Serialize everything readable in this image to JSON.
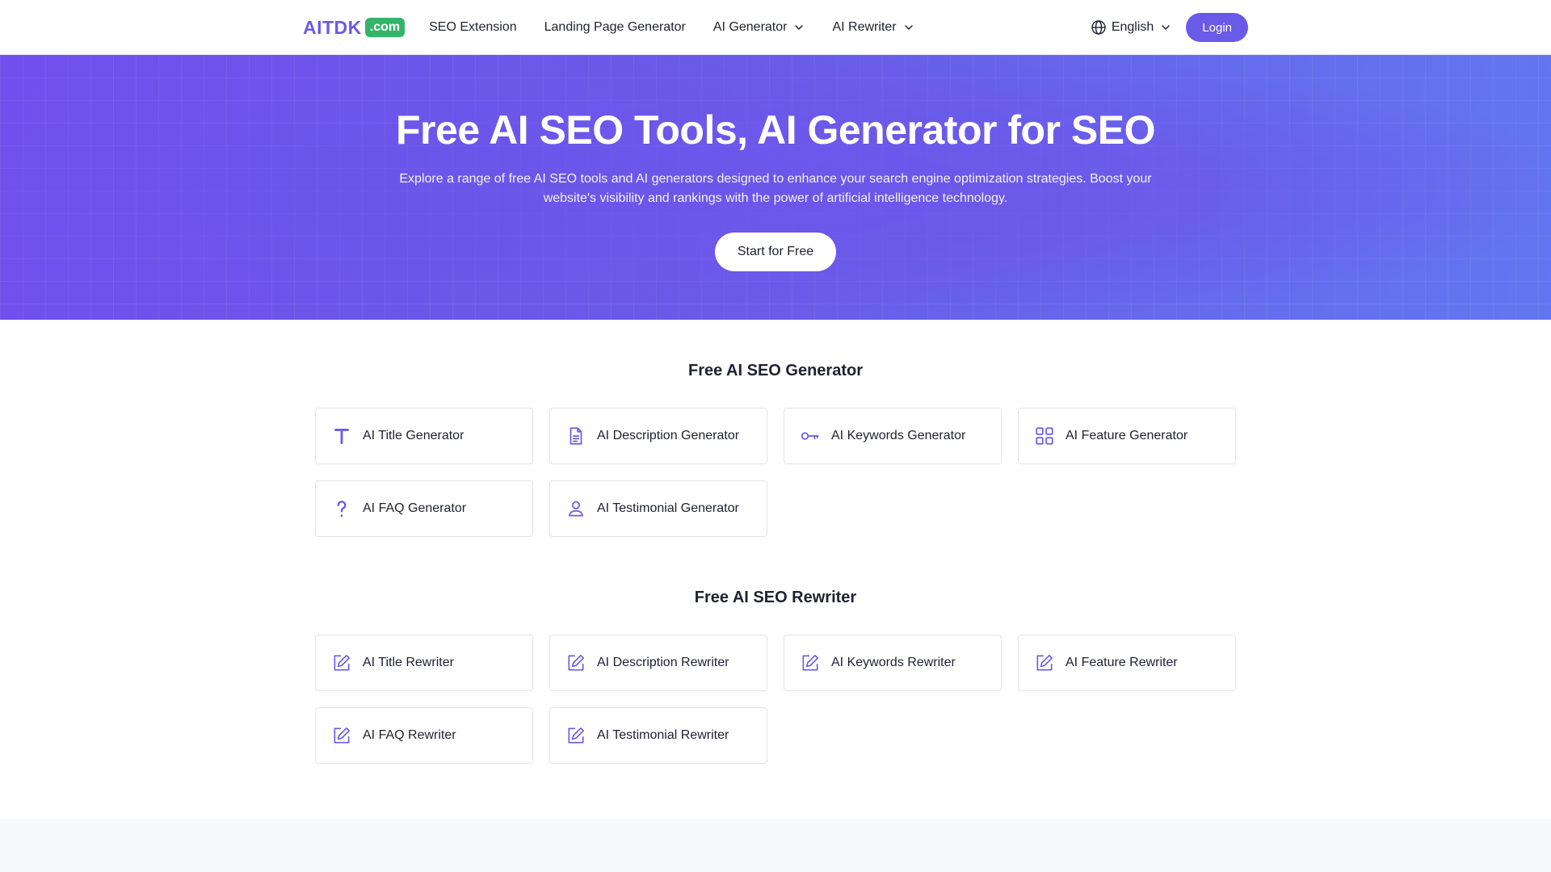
{
  "header": {
    "logo_text": "AITDK",
    "logo_badge": ".com",
    "nav": [
      {
        "label": "SEO Extension"
      },
      {
        "label": "Landing Page Generator"
      },
      {
        "label": "AI Generator"
      },
      {
        "label": "AI Rewriter"
      }
    ],
    "language": "English",
    "login_label": "Login"
  },
  "hero": {
    "title": "Free AI SEO Tools, AI Generator for SEO",
    "description": "Explore a range of free AI SEO tools and AI generators designed to enhance your search engine optimization strategies. Boost your website's visibility and rankings with the power of artificial intelligence technology.",
    "cta_label": "Start for Free"
  },
  "generator": {
    "title": "Free AI SEO Generator",
    "items": [
      {
        "label": "AI Title Generator",
        "icon": "text-t-icon"
      },
      {
        "label": "AI Description Generator",
        "icon": "document-icon"
      },
      {
        "label": "AI Keywords Generator",
        "icon": "key-icon"
      },
      {
        "label": "AI Feature Generator",
        "icon": "grid-icon"
      },
      {
        "label": "AI FAQ Generator",
        "icon": "question-icon"
      },
      {
        "label": "AI Testimonial Generator",
        "icon": "user-icon"
      }
    ]
  },
  "rewriter": {
    "title": "Free AI SEO Rewriter",
    "items": [
      {
        "label": "AI Title Rewriter",
        "icon": "edit-icon"
      },
      {
        "label": "AI Description Rewriter",
        "icon": "edit-icon"
      },
      {
        "label": "AI Keywords Rewriter",
        "icon": "edit-icon"
      },
      {
        "label": "AI Feature Rewriter",
        "icon": "edit-icon"
      },
      {
        "label": "AI FAQ Rewriter",
        "icon": "edit-icon"
      },
      {
        "label": "AI Testimonial Rewriter",
        "icon": "edit-icon"
      }
    ]
  },
  "colors": {
    "accent": "#6a5ae8",
    "badge": "#34b36a",
    "hero_start": "#7050ec",
    "hero_end": "#6277f0"
  }
}
